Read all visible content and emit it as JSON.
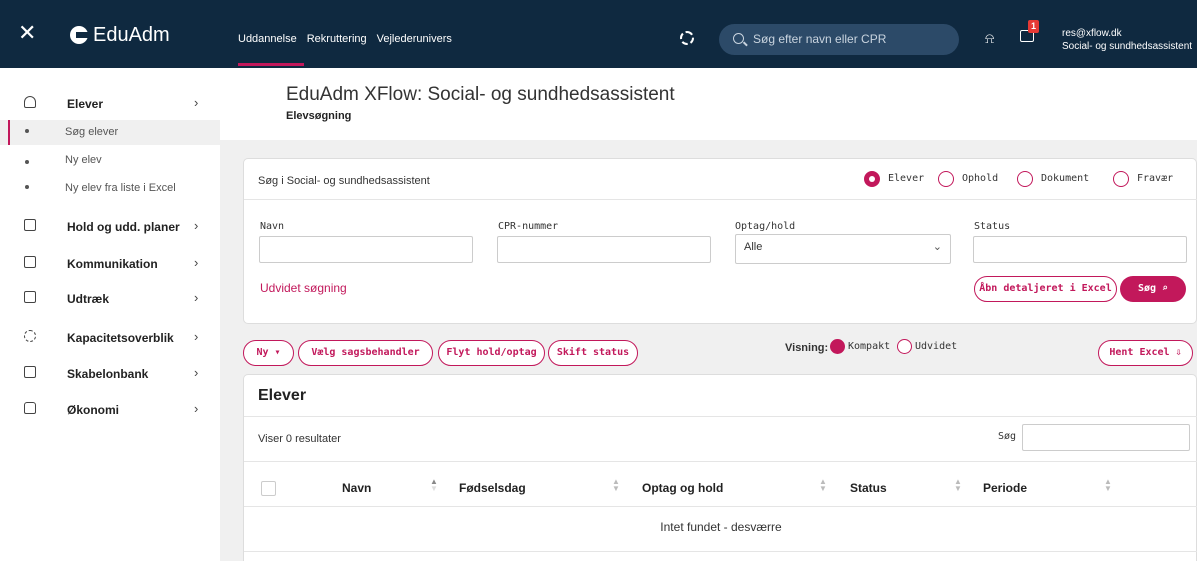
{
  "app": {
    "brand": "EduAdm"
  },
  "topnav": [
    "Uddannelse",
    "Rekruttering",
    "Vejlederunivers"
  ],
  "search": {
    "placeholder": "Søg efter navn eller CPR"
  },
  "notifications": {
    "chat_count": "1"
  },
  "user": {
    "email": "res@xflow.dk",
    "role": "Social- og sundhedsassistent"
  },
  "sidebar": {
    "items": [
      {
        "label": "Elever",
        "icon": "person-icon",
        "chevron": "›"
      },
      {
        "label": "Hold og udd. planer",
        "icon": "calendar-icon",
        "chevron": "›"
      },
      {
        "label": "Kommunikation",
        "icon": "message-icon",
        "chevron": "›"
      },
      {
        "label": "Udtræk",
        "icon": "document-icon",
        "chevron": "›"
      },
      {
        "label": "Kapacitetsoverblik",
        "icon": "capacity-icon",
        "chevron": "›"
      },
      {
        "label": "Skabelonbank",
        "icon": "template-icon",
        "chevron": "›"
      },
      {
        "label": "Økonomi",
        "icon": "wallet-icon",
        "chevron": "›"
      }
    ],
    "subitems": [
      "Søg elever",
      "Ny elev",
      "Ny elev fra liste i Excel"
    ]
  },
  "header": {
    "title": "EduAdm XFlow: Social- og sundhedsassistent",
    "subtitle": "Elevsøgning"
  },
  "search_card": {
    "caption": "Søg i Social- og sundhedsassistent",
    "radios": [
      "Elever",
      "Ophold",
      "Dokument",
      "Fravær"
    ],
    "selected_radio": "Elever",
    "fields": {
      "name_label": "Navn",
      "cpr_label": "CPR-nummer",
      "optag_label": "Optag/hold",
      "optag_value": "Alle",
      "status_label": "Status"
    },
    "advanced": "Udvidet søgning",
    "excel_button": "Åbn detaljeret i Excel",
    "search_button": "Søg"
  },
  "actions": {
    "new": "Ny ▾",
    "assign": "Vælg sagsbehandler",
    "move": "Flyt hold/optag",
    "status": "Skift status",
    "visning_label": "Visning:",
    "views": [
      "Kompakt",
      "Udvidet"
    ],
    "selected_view": "Kompakt",
    "excel": "Hent Excel"
  },
  "results": {
    "heading": "Elever",
    "count": "Viser 0 resultater",
    "search_label": "Søg",
    "columns": [
      "Navn",
      "Fødselsdag",
      "Optag og hold",
      "Status",
      "Periode"
    ],
    "empty": "Intet fundet - desværre"
  },
  "colors": {
    "topbar": "#0f2940",
    "accent": "#c2185b"
  }
}
